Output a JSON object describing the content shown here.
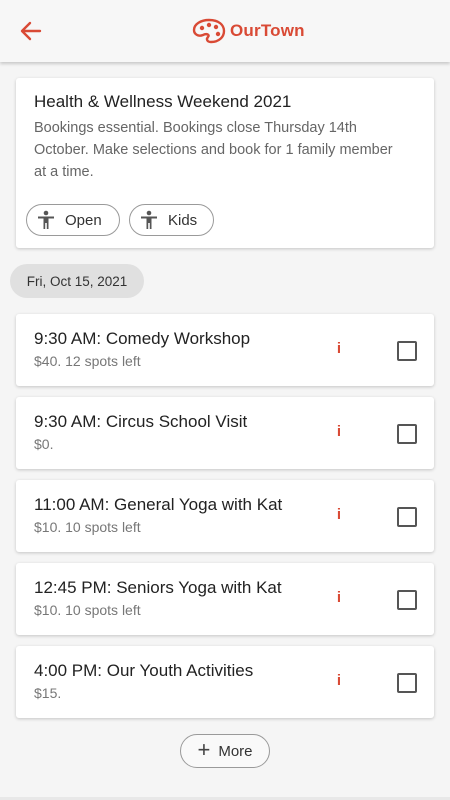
{
  "header": {
    "back_icon": "arrow-left-icon",
    "brand_name": "OurTown",
    "brand_color": "#d94a35"
  },
  "event": {
    "title": "Health & Wellness Weekend 2021",
    "description": "Bookings essential. Bookings close Thursday 14th October. Make selections and book for 1 family member at a time.",
    "tags": [
      {
        "label": "Open",
        "icon": "person-icon"
      },
      {
        "label": "Kids",
        "icon": "person-icon"
      }
    ]
  },
  "date_label": "Fri, Oct 15, 2021",
  "sessions": [
    {
      "title": "9:30 AM: Comedy Workshop",
      "subtitle": "$40. 12 spots left",
      "checked": false
    },
    {
      "title": "9:30 AM: Circus School Visit",
      "subtitle": "$0.",
      "checked": false
    },
    {
      "title": "11:00 AM: General Yoga with Kat",
      "subtitle": "$10. 10 spots left",
      "checked": false
    },
    {
      "title": "12:45 PM: Seniors Yoga with Kat",
      "subtitle": "$10. 10 spots left",
      "checked": false
    },
    {
      "title": "4:00 PM: Our Youth Activities",
      "subtitle": "$15.",
      "checked": false
    }
  ],
  "info_glyph": "i",
  "more_button": {
    "label": "More",
    "icon": "plus-icon"
  }
}
